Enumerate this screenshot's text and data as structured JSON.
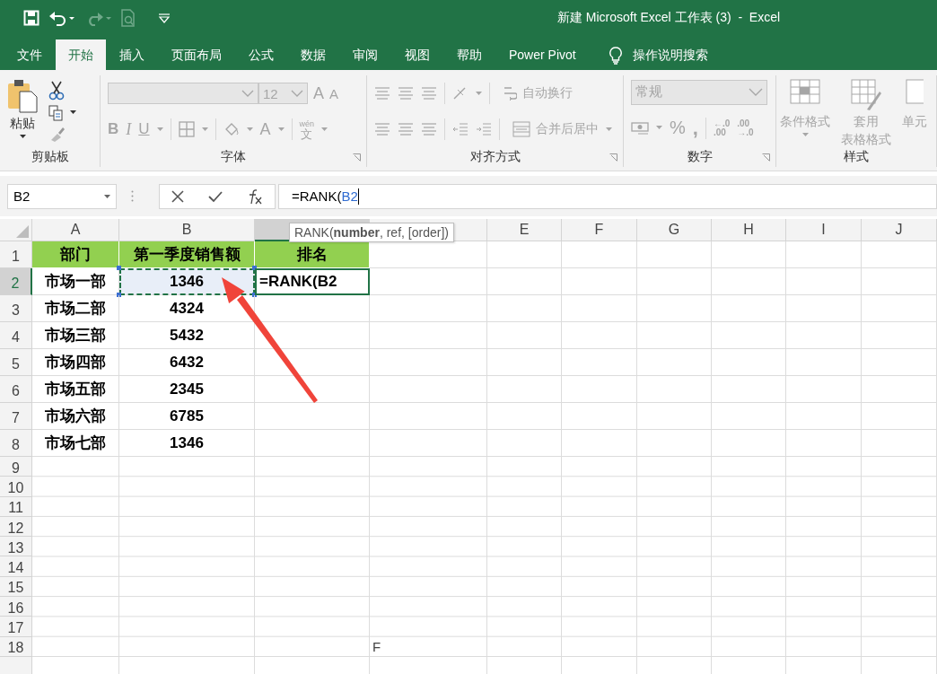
{
  "quick_access": [
    {
      "kind": "save",
      "disabled": false
    },
    {
      "kind": "undo",
      "disabled": false
    },
    {
      "kind": "redo",
      "disabled": true
    },
    {
      "kind": "preview",
      "disabled": true
    },
    {
      "kind": "customize",
      "disabled": false
    }
  ],
  "window": {
    "title": "新建 Microsoft Excel 工作表 (3)  -  Excel"
  },
  "tabs": [
    {
      "label": "文件",
      "selected": false
    },
    {
      "label": "开始",
      "selected": true
    },
    {
      "label": "插入",
      "selected": false
    },
    {
      "label": "页面布局",
      "selected": false
    },
    {
      "label": "公式",
      "selected": false
    },
    {
      "label": "数据",
      "selected": false
    },
    {
      "label": "审阅",
      "selected": false
    },
    {
      "label": "视图",
      "selected": false
    },
    {
      "label": "帮助",
      "selected": false
    },
    {
      "label": "Power Pivot",
      "selected": false
    }
  ],
  "search": {
    "label": "操作说明搜索"
  },
  "ribbon": {
    "groups": [
      {
        "kind": "clipboard",
        "label": "剪贴板",
        "disabled": false,
        "paste": "粘贴"
      },
      {
        "kind": "font",
        "label": "字体",
        "disabled": true,
        "font_size": "12",
        "grow": "A",
        "shrink": "A",
        "bold": "B",
        "italic": "I",
        "underline": "U",
        "font_color": "A",
        "phonetic": [
          "wén",
          "文"
        ]
      },
      {
        "kind": "alignment",
        "label": "对齐方式",
        "disabled": true,
        "wrap": "自动换行",
        "merge": "合并后居中"
      },
      {
        "kind": "number",
        "label": "数字",
        "disabled": true,
        "format": "常规",
        "percent": "%",
        "comma": ",",
        "increase_decimal": [
          "←.0",
          ".00"
        ],
        "decrease_decimal": [
          ".00",
          "→.0"
        ]
      },
      {
        "kind": "styles",
        "label": "样式",
        "disabled": true,
        "conditional": "条件格式",
        "table_format": [
          "套用",
          "表格格式"
        ],
        "cell_styles": "单元"
      }
    ]
  },
  "formula_bar": {
    "name_box": "B2",
    "formula": "=RANK(",
    "reference": "B2"
  },
  "tooltip": "RANK(**number**, ref, [order])",
  "grid": {
    "columns": [
      {
        "label": "A",
        "selected": false
      },
      {
        "label": "B",
        "selected": false
      },
      {
        "selected": true
      },
      {
        "selected": false
      },
      {
        "label": "E",
        "selected": false
      },
      {
        "label": "F",
        "selected": false
      },
      {
        "label": "G",
        "selected": false
      },
      {
        "label": "H",
        "selected": false
      },
      {
        "label": "I",
        "selected": false
      },
      {
        "label": "J",
        "selected": false
      }
    ],
    "rows": [
      {
        "label": "1",
        "selected": false,
        "cells": [
          {
            "text": "部门",
            "kind": "header"
          },
          {
            "text": "第一季度销售额",
            "kind": "header"
          },
          {
            "text": "排名",
            "kind": "header"
          }
        ]
      },
      {
        "label": "2",
        "selected": true,
        "cells": [
          {
            "text": "市场一部",
            "kind": "data"
          },
          {
            "text": "1346",
            "kind": "copied"
          },
          {
            "text": "=RANK(B2",
            "kind": "editing"
          }
        ]
      },
      {
        "label": "3",
        "selected": false,
        "cells": [
          {
            "text": "市场二部",
            "kind": "data"
          },
          {
            "text": "4324",
            "kind": "data"
          }
        ]
      },
      {
        "label": "4",
        "selected": false,
        "cells": [
          {
            "text": "市场三部",
            "kind": "data"
          },
          {
            "text": "5432",
            "kind": "data"
          }
        ]
      },
      {
        "label": "5",
        "selected": false,
        "cells": [
          {
            "text": "市场四部",
            "kind": "data"
          },
          {
            "text": "6432",
            "kind": "data"
          }
        ]
      },
      {
        "label": "6",
        "selected": false,
        "cells": [
          {
            "text": "市场五部",
            "kind": "data"
          },
          {
            "text": "2345",
            "kind": "data"
          }
        ]
      },
      {
        "label": "7",
        "selected": false,
        "cells": [
          {
            "text": "市场六部",
            "kind": "data"
          },
          {
            "text": "6785",
            "kind": "data"
          }
        ]
      },
      {
        "label": "8",
        "selected": false,
        "cells": [
          {
            "text": "市场七部",
            "kind": "data"
          },
          {
            "text": "1346",
            "kind": "data"
          }
        ]
      },
      {
        "label": "9",
        "selected": false
      },
      {
        "label": "10",
        "selected": false
      },
      {
        "label": "11",
        "selected": false
      },
      {
        "label": "12",
        "selected": false
      },
      {
        "label": "13",
        "selected": false
      },
      {
        "label": "14",
        "selected": false
      },
      {
        "label": "15",
        "selected": false
      },
      {
        "label": "16",
        "selected": false
      },
      {
        "label": "17",
        "selected": false
      },
      {
        "label": "18",
        "selected": false,
        "note": "F"
      }
    ]
  }
}
